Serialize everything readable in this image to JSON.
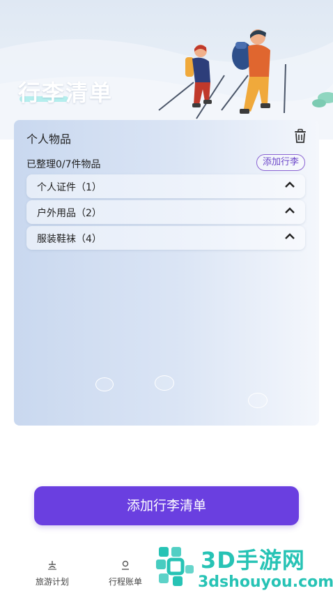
{
  "header": {
    "title": "行李清单",
    "illustration": "hikers-illustration"
  },
  "card": {
    "title": "个人物品",
    "progress_text": "已整理0/7件物品",
    "add_chip_label": "添加行李",
    "trash_icon": "trash-icon",
    "categories": [
      {
        "label": "个人证件（1）",
        "icon": "chevron-up-icon"
      },
      {
        "label": "户外用品（2）",
        "icon": "chevron-up-icon"
      },
      {
        "label": "服装鞋袜（4）",
        "icon": "chevron-up-icon"
      }
    ]
  },
  "primary_action": {
    "label": "添加行李清单"
  },
  "tabbar": {
    "items": [
      {
        "label": "旅游计划",
        "icon": "plan-icon"
      },
      {
        "label": "行程账单",
        "icon": "bill-icon"
      }
    ]
  },
  "watermark": {
    "brand": "3D手游网",
    "url": "3dshouyou.com"
  },
  "colors": {
    "accent": "#6a3fe0",
    "chip_border": "#8a63d2",
    "watermark": "#27c3b5"
  }
}
